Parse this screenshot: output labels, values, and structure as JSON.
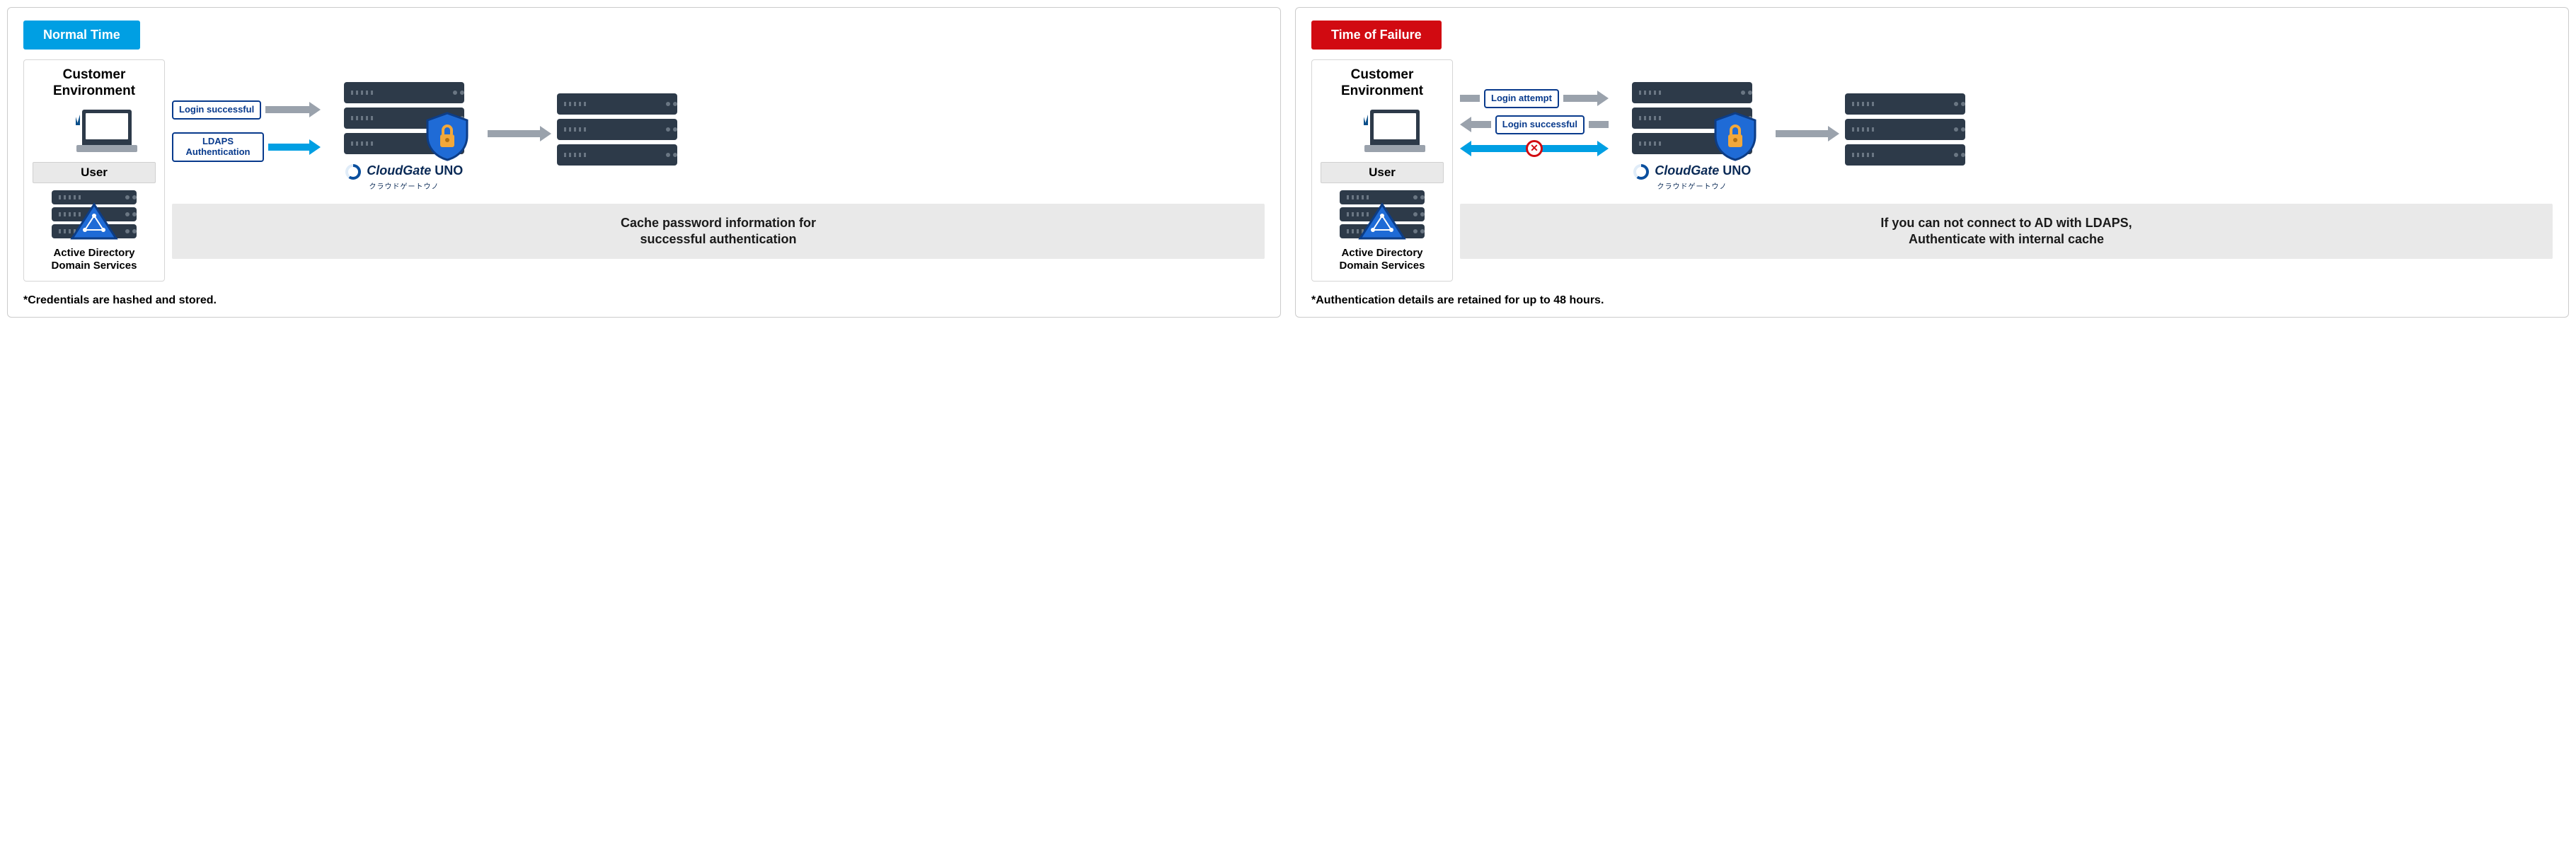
{
  "panels": {
    "normal": {
      "badge": "Normal Time",
      "env_title_l1": "Customer",
      "env_title_l2": "Environment",
      "user_label": "User",
      "ad_label_l1": "Active Directory",
      "ad_label_l2": "Domain Services",
      "arrow1_label": "Login successful",
      "arrow2_label_l1": "LDAPS",
      "arrow2_label_l2": "Authentication",
      "cg_name": "CloudGate",
      "cg_suffix": "UNO",
      "cg_sub": "クラウドゲートウノ",
      "caption_l1": "Cache password information for",
      "caption_l2": "successful authentication",
      "footnote": "*Credentials are hashed and stored."
    },
    "failure": {
      "badge": "Time of Failure",
      "env_title_l1": "Customer",
      "env_title_l2": "Environment",
      "user_label": "User",
      "ad_label_l1": "Active Directory",
      "ad_label_l2": "Domain Services",
      "arrow1_label": "Login attempt",
      "arrow2_label": "Login successful",
      "x_glyph": "✕",
      "cg_name": "CloudGate",
      "cg_suffix": "UNO",
      "cg_sub": "クラウドゲートウノ",
      "caption_l1": "If you can not connect to AD with LDAPS,",
      "caption_l2": "Authenticate with internal cache",
      "footnote": "*Authentication details are retained for up to 48 hours."
    }
  }
}
